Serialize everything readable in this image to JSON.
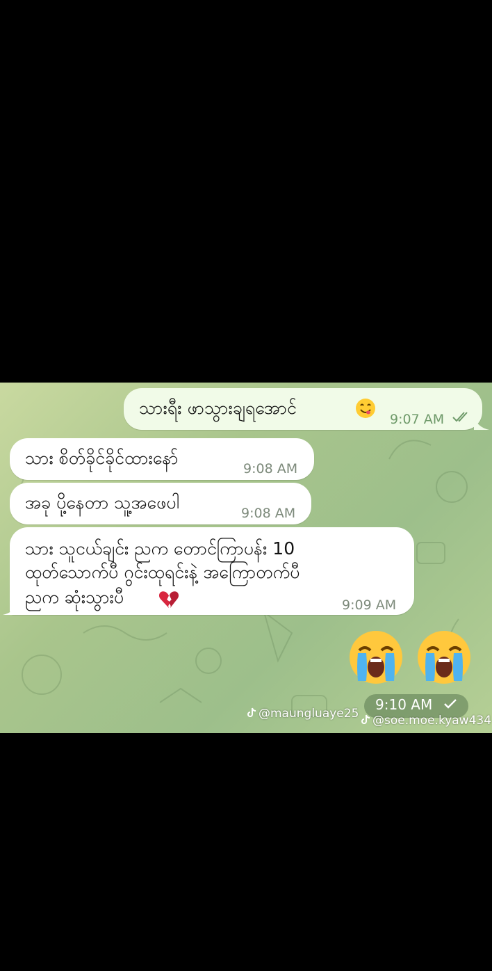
{
  "messages": [
    {
      "text": "သားရီး ဖာသွားချရအောင်",
      "time": "9:07 AM",
      "status": "read",
      "emoji": "yum-face-icon"
    },
    {
      "text": "သား စိတ်ခိုင်ခိုင်ထားနော်",
      "time": "9:08 AM"
    },
    {
      "text": "အခု ပို့နေတာ သူ့အဖေပါ",
      "time": "9:08 AM"
    },
    {
      "lines": [
        "သား သူငယ်ချင်း ညက တောင်ကြာပန်း 10",
        "ထုတ်သောက်ပီ ဂွင်းထုရင်းနဲ့ အကြောတက်ပီ",
        "ညက ဆုံးသွားပီ"
      ],
      "time": "9:09 AM",
      "emoji": "broken-heart-icon"
    }
  ],
  "sticker": {
    "emojis": [
      "loudly-crying-face-icon",
      "loudly-crying-face-icon"
    ],
    "time": "9:10 AM",
    "status": "sent"
  },
  "watermarks": [
    "@maungluaye25",
    "@soe.moe.kyaw434"
  ],
  "colors": {
    "bubble_in": "#ffffff",
    "bubble_out": "#f1fbe8",
    "time_out": "#6f9a6a",
    "background": "#000000"
  }
}
